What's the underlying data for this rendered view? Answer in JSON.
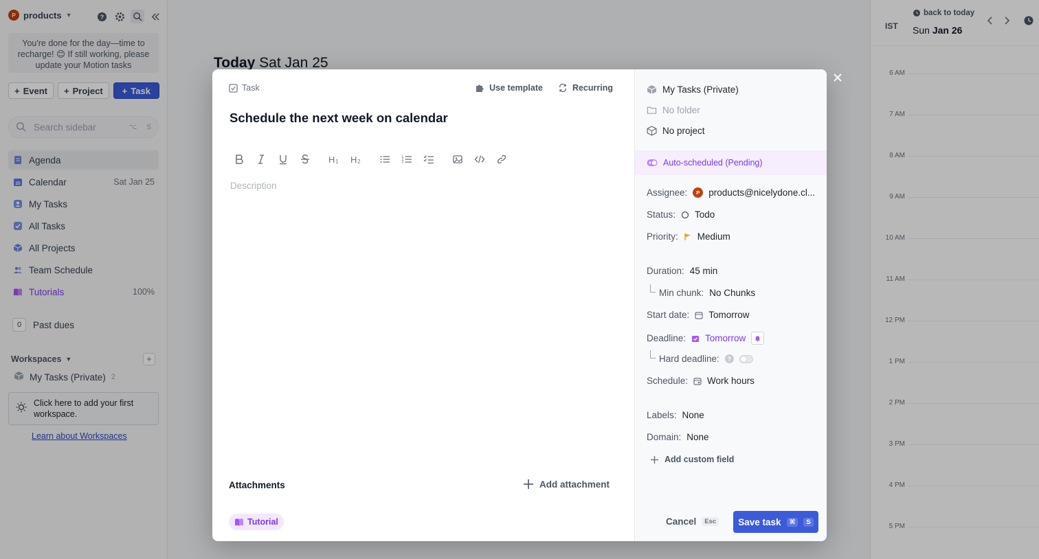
{
  "sidebar": {
    "workspace_name": "products",
    "workspace_avatar": "P",
    "notice": "You're done for the day—time to recharge! 😊 If still working, please update your Motion tasks",
    "create": {
      "event": "Event",
      "project": "Project",
      "task": "Task"
    },
    "search": {
      "placeholder": "Search sidebar",
      "shortcut_a": "⌥",
      "shortcut_b": "S"
    },
    "nav": [
      {
        "label": "Agenda",
        "meta": "",
        "icon": "agenda-icon"
      },
      {
        "label": "Calendar",
        "meta": "Sat Jan 25",
        "icon": "calendar-icon"
      },
      {
        "label": "My Tasks",
        "meta": "",
        "icon": "user-icon"
      },
      {
        "label": "All Tasks",
        "meta": "",
        "icon": "check-icon"
      },
      {
        "label": "All Projects",
        "meta": "",
        "icon": "cube-icon"
      },
      {
        "label": "Team Schedule",
        "meta": "",
        "icon": "team-icon"
      },
      {
        "label": "Tutorials",
        "meta": "100%",
        "icon": "book-icon"
      }
    ],
    "past_dues": {
      "count": "0",
      "label": "Past dues"
    },
    "workspaces": {
      "label": "Workspaces",
      "item": "My Tasks (Private)",
      "item_count": "2"
    },
    "ws_card": "Click here to add your first workspace.",
    "learn": "Learn about Workspaces"
  },
  "main": {
    "title_bold": "Today",
    "title_rest": "Sat Jan 25"
  },
  "rightcal": {
    "tz": "IST",
    "back": "back to today",
    "day": "Sun",
    "date": "Jan 26",
    "hours": [
      "6 AM",
      "7 AM",
      "8 AM",
      "9 AM",
      "10 AM",
      "11 AM",
      "12 PM",
      "1 PM",
      "2 PM",
      "3 PM",
      "4 PM",
      "5 PM"
    ]
  },
  "modal": {
    "type": "Task",
    "use_template": "Use template",
    "recurring": "Recurring",
    "title": "Schedule the next week on calendar",
    "description_placeholder": "Description",
    "attachments": "Attachments",
    "add_attachment": "Add attachment",
    "tag": "Tutorial",
    "right": {
      "workspace": "My Tasks (Private)",
      "folder": "No folder",
      "project": "No project",
      "auto_scheduled": "Auto-scheduled (Pending)",
      "assignee_label": "Assignee:",
      "assignee": "products@nicelydone.cl...",
      "status_label": "Status:",
      "status": "Todo",
      "priority_label": "Priority:",
      "priority": "Medium",
      "duration_label": "Duration:",
      "duration": "45 min",
      "min_chunk_label": "Min chunk:",
      "min_chunk": "No Chunks",
      "start_label": "Start date:",
      "start": "Tomorrow",
      "deadline_label": "Deadline:",
      "deadline": "Tomorrow",
      "hard_deadline_label": "Hard deadline:",
      "schedule_label": "Schedule:",
      "schedule": "Work hours",
      "labels_label": "Labels:",
      "labels": "None",
      "domain_label": "Domain:",
      "domain": "None",
      "add_custom_field": "Add custom field"
    },
    "cancel": "Cancel",
    "cancel_kbd": "Esc",
    "save": "Save task",
    "save_kbd_a": "⌘",
    "save_kbd_b": "S"
  },
  "colors": {
    "accent": "#3b5bdb",
    "purple": "#7c3aed",
    "avatar": "#c2410c",
    "priority": "#f59e0b"
  }
}
